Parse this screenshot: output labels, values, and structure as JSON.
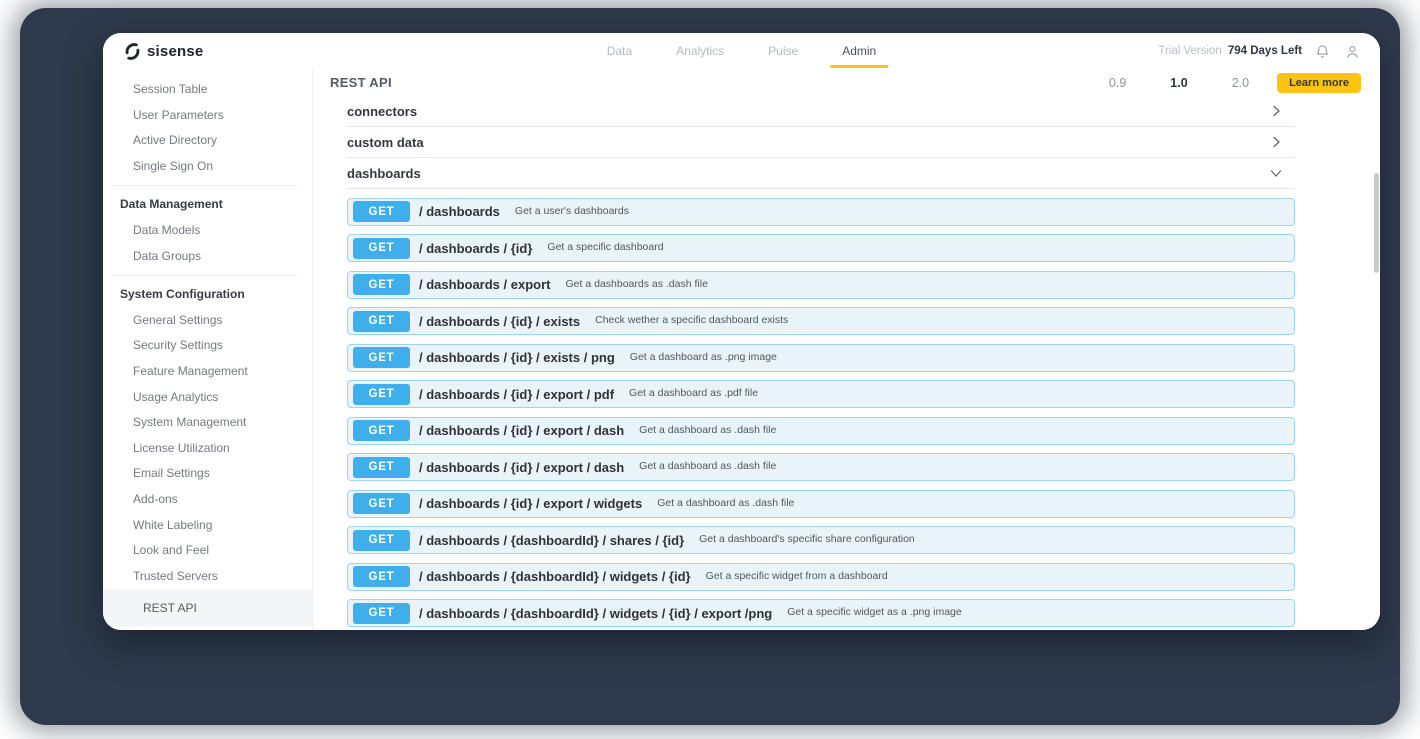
{
  "colors": {
    "brand_dark": "#21252b",
    "accent_yellow": "#f9c414",
    "method_blue": "#3eafea",
    "row_bg": "#e9f3fa",
    "row_border": "#9dd4f1",
    "backdrop": "#2e3a4b"
  },
  "brand": {
    "name": "sisense"
  },
  "topnav": {
    "items": [
      {
        "label": "Data",
        "active": false
      },
      {
        "label": "Analytics",
        "active": false
      },
      {
        "label": "Pulse",
        "active": false
      },
      {
        "label": "Admin",
        "active": true
      }
    ],
    "trial_label": "Trial Version",
    "trial_value": "794 Days Left"
  },
  "header": {
    "title": "REST API",
    "versions": [
      {
        "label": "0.9",
        "active": false
      },
      {
        "label": "1.0",
        "active": true
      },
      {
        "label": "2.0",
        "active": false
      }
    ],
    "learn_more": "Learn more"
  },
  "sidebar": {
    "groups": [
      {
        "header": null,
        "items": [
          "Session Table",
          "User Parameters",
          "Active Directory",
          "Single Sign On"
        ]
      },
      {
        "header": "Data Management",
        "items": [
          "Data Models",
          "Data Groups"
        ]
      },
      {
        "header": "System Configuration",
        "items": [
          "General Settings",
          "Security Settings",
          "Feature Management",
          "Usage Analytics",
          "System Management",
          "License Utilization",
          "Email Settings",
          "Add-ons",
          "White Labeling",
          "Look and Feel",
          "Trusted Servers"
        ]
      }
    ],
    "selected_item": "REST API"
  },
  "api": {
    "sections": [
      {
        "label": "connectors",
        "expanded": false
      },
      {
        "label": "custom data",
        "expanded": false
      },
      {
        "label": "dashboards",
        "expanded": true
      }
    ],
    "endpoints": [
      {
        "method": "GET",
        "path": "/ dashboards",
        "description": "Get a user's dashboards"
      },
      {
        "method": "GET",
        "path": "/ dashboards / {id}",
        "description": "Get a specific dashboard"
      },
      {
        "method": "GET",
        "path": "/ dashboards / export",
        "description": "Get a dashboards as .dash file"
      },
      {
        "method": "GET",
        "path": "/ dashboards / {id} / exists",
        "description": "Check wether a specific dashboard exists"
      },
      {
        "method": "GET",
        "path": "/ dashboards / {id} / exists / png",
        "description": "Get a dashboard as .png image"
      },
      {
        "method": "GET",
        "path": "/ dashboards / {id} / export / pdf",
        "description": "Get a dashboard as .pdf file"
      },
      {
        "method": "GET",
        "path": "/ dashboards / {id} / export / dash",
        "description": "Get a dashboard as .dash file"
      },
      {
        "method": "GET",
        "path": "/ dashboards / {id} / export / dash",
        "description": "Get a dashboard as .dash file"
      },
      {
        "method": "GET",
        "path": "/ dashboards / {id} / export / widgets",
        "description": "Get a dashboard as .dash file"
      },
      {
        "method": "GET",
        "path": "/ dashboards / {dashboardId} / shares / {id}",
        "description": "Get a dashboard's specific share configuration"
      },
      {
        "method": "GET",
        "path": "/ dashboards / {dashboardId} / widgets / {id}",
        "description": "Get a specific widget from a dashboard"
      },
      {
        "method": "GET",
        "path": "/ dashboards / {dashboardId} / widgets / {id} / export /png",
        "description": "Get a specific widget as a .png image"
      }
    ]
  }
}
